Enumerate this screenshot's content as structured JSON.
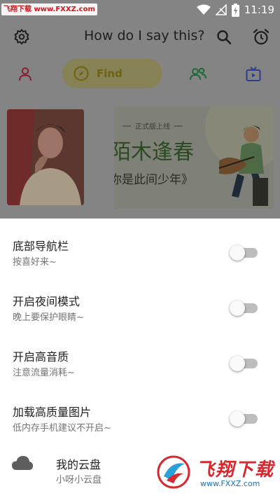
{
  "watermark_top": "飞翔下载 www.FXXZ.com",
  "status_bar": {
    "time": "11:19",
    "battery_icon": "battery-charging-icon"
  },
  "app_bar": {
    "title": "How do I say this?"
  },
  "tabs": {
    "find_label": "Find"
  },
  "banner": {
    "tag": "正式版上线",
    "headline": "陌木逢春",
    "subline": "你是此间少年》"
  },
  "settings": [
    {
      "title": "底部导航栏",
      "subtitle": "按喜好来~",
      "enabled": false
    },
    {
      "title": "开启夜间模式",
      "subtitle": "晚上要保护眼睛~",
      "enabled": false
    },
    {
      "title": "开启高音质",
      "subtitle": "注意流量消耗~",
      "enabled": false
    },
    {
      "title": "加载高质量图片",
      "subtitle": "低内存手机建议不开启~",
      "enabled": false
    }
  ],
  "cloud": {
    "title": "我的云盘",
    "subtitle": "小呀小云盘"
  },
  "watermark_bottom": {
    "brand": "飞翔下载",
    "url": "www.FXXZ.com"
  },
  "colors": {
    "scrim": "#848484",
    "find_pill": "#868255",
    "find_text": "#6d6310",
    "toggle_track": "#bdbdbd"
  }
}
